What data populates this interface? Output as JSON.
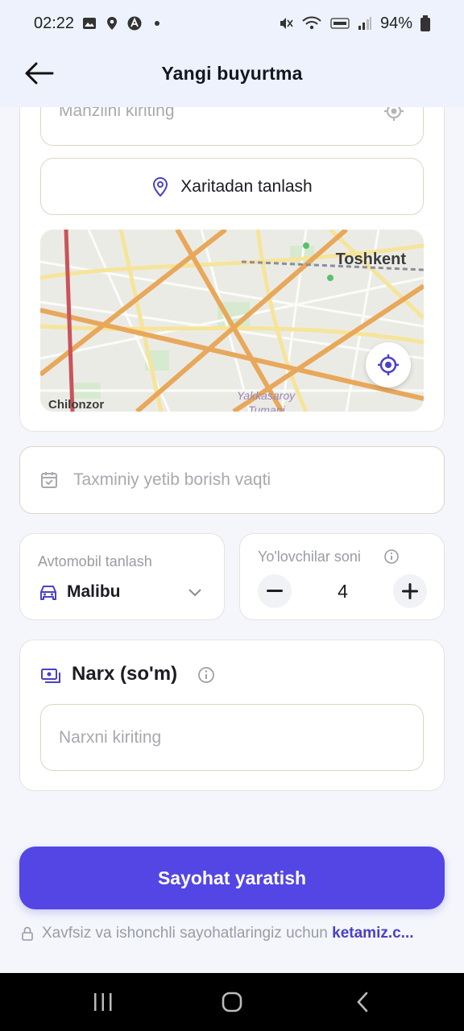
{
  "status_bar": {
    "time": "02:22",
    "battery": "94%"
  },
  "header": {
    "title": "Yangi buyurtma"
  },
  "address": {
    "placeholder": "Manzilni kiriting"
  },
  "map_select_button": "Xaritadan tanlash",
  "map": {
    "city_label": "Toshkent",
    "district_left": "Chilonzor",
    "district_bottom": "Yakkasaroy",
    "district_bottom_2": "Tumani"
  },
  "arrival_time": {
    "placeholder": "Taxminiy yetib borish vaqti"
  },
  "car": {
    "label": "Avtomobil tanlash",
    "value": "Malibu"
  },
  "passengers": {
    "label": "Yo'lovchilar soni",
    "count": "4"
  },
  "price": {
    "title": "Narx (so'm)",
    "placeholder": "Narxni kiriting"
  },
  "submit_button": "Sayohat yaratish",
  "footnote": {
    "text": "Xavfsiz va ishonchli sayohatlaringiz uchun ",
    "brand": "ketamiz.c..."
  },
  "colors": {
    "primary": "#5346e4",
    "header_bg": "#eef2fc",
    "page_bg": "#f4f6fb"
  }
}
